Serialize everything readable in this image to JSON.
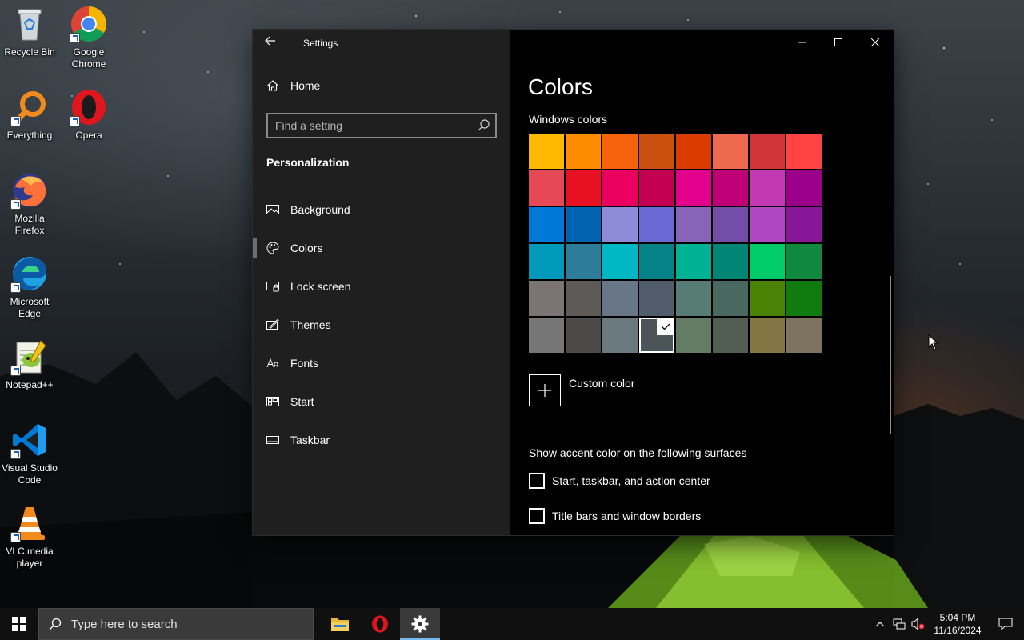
{
  "desktop": {
    "icons": [
      {
        "label": "Recycle Bin"
      },
      {
        "label": "Google Chrome"
      },
      {
        "label": "Everything"
      },
      {
        "label": "Opera"
      },
      {
        "label": "Mozilla Firefox"
      },
      {
        "label": "Microsoft Edge"
      },
      {
        "label": "Notepad++"
      },
      {
        "label": "Visual Studio Code"
      },
      {
        "label": "VLC media player"
      }
    ]
  },
  "window": {
    "title": "Settings",
    "home_label": "Home",
    "search_placeholder": "Find a setting",
    "section": "Personalization",
    "nav_items": [
      {
        "label": "Background",
        "icon": "picture-icon"
      },
      {
        "label": "Colors",
        "icon": "palette-icon"
      },
      {
        "label": "Lock screen",
        "icon": "lock-screen-icon"
      },
      {
        "label": "Themes",
        "icon": "themes-icon"
      },
      {
        "label": "Fonts",
        "icon": "fonts-icon"
      },
      {
        "label": "Start",
        "icon": "start-icon"
      },
      {
        "label": "Taskbar",
        "icon": "taskbar-icon"
      }
    ],
    "selected_nav": "Colors"
  },
  "content": {
    "title": "Colors",
    "windows_colors_label": "Windows colors",
    "swatches": [
      [
        "#FFB900",
        "#FF8C00",
        "#F7630C",
        "#CA5010",
        "#DA3B01",
        "#EF6950",
        "#D13438",
        "#FF4343"
      ],
      [
        "#E74856",
        "#E81123",
        "#EA005E",
        "#C30052",
        "#E3008C",
        "#BF0077",
        "#C239B3",
        "#9A0089"
      ],
      [
        "#0078D7",
        "#0063B1",
        "#8E8CD8",
        "#6B69D6",
        "#8764B8",
        "#744DA9",
        "#B146C2",
        "#881798"
      ],
      [
        "#0099BC",
        "#2D7D9A",
        "#00B7C3",
        "#038387",
        "#00B294",
        "#018574",
        "#00CC6A",
        "#10893E"
      ],
      [
        "#7A7574",
        "#5D5A58",
        "#68768A",
        "#515C6B",
        "#567C73",
        "#486860",
        "#498205",
        "#107C10"
      ],
      [
        "#767676",
        "#4C4A48",
        "#69797E",
        "#4A5459",
        "#647C64",
        "#525E54",
        "#847545",
        "#7E735F"
      ]
    ],
    "selected_swatch": {
      "row": 5,
      "col": 3
    },
    "custom_color_label": "Custom color",
    "surfaces_label": "Show accent color on the following surfaces",
    "checkboxes": [
      {
        "label": "Start, taskbar, and action center",
        "checked": false
      },
      {
        "label": "Title bars and window borders",
        "checked": false
      }
    ]
  },
  "taskbar": {
    "search_placeholder": "Type here to search",
    "clock_time": "5:04 PM",
    "clock_date": "11/16/2024"
  }
}
